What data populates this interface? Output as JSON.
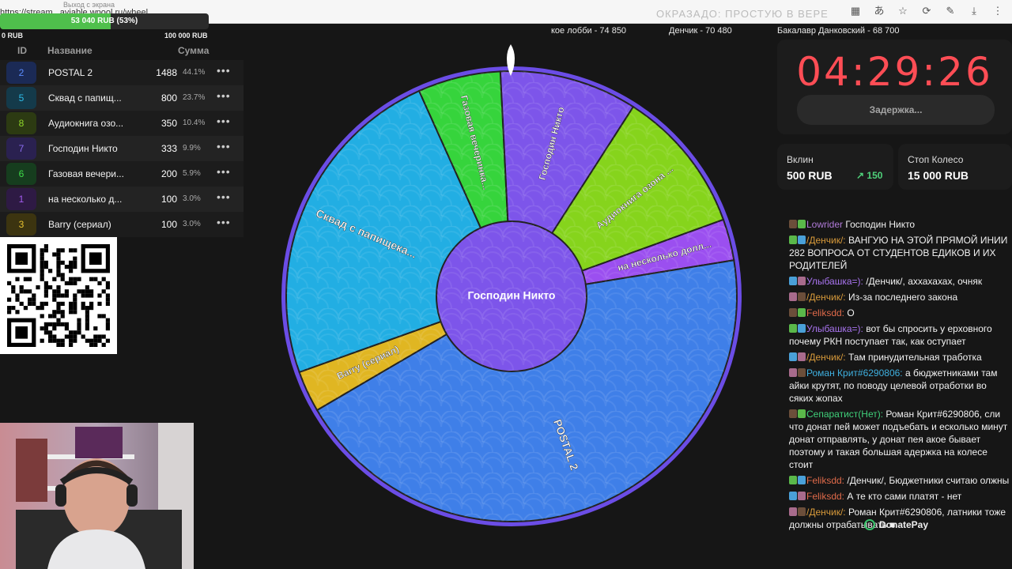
{
  "browser": {
    "url": "https://stream...aviable.wpool.ru/wheel",
    "tab_title": "Выход с экрана",
    "faded_overlay": "ОКРАЗАДО: ПРОСТУЮ В ВЕРЕ"
  },
  "progress": {
    "label": "53 040 RUB (53%)",
    "fraction": 0.53,
    "min_label": "0 RUB",
    "max_label": "100 000 RUB"
  },
  "table": {
    "headers": {
      "id": "ID",
      "name": "Название",
      "sum": "Сумма"
    },
    "rows": [
      {
        "id": "2",
        "name": "POSTAL 2",
        "sum": "1488",
        "pct": "44.1%",
        "color": "#1b2a55",
        "text_color": "#5b8cff"
      },
      {
        "id": "5",
        "name": "Сквад с папищ...",
        "sum": "800",
        "pct": "23.7%",
        "color": "#143a4a",
        "text_color": "#2dbce8"
      },
      {
        "id": "8",
        "name": "Аудиокнига озо...",
        "sum": "350",
        "pct": "10.4%",
        "color": "#2c3a12",
        "text_color": "#8fd82a"
      },
      {
        "id": "7",
        "name": "Господин Никто",
        "sum": "333",
        "pct": "9.9%",
        "color": "#2a2150",
        "text_color": "#8b6cf0"
      },
      {
        "id": "6",
        "name": "Газовая вечери...",
        "sum": "200",
        "pct": "5.9%",
        "color": "#163d1e",
        "text_color": "#3fdc4a"
      },
      {
        "id": "1",
        "name": "на несколько д...",
        "sum": "100",
        "pct": "3.0%",
        "color": "#2e1a44",
        "text_color": "#a35cf0"
      },
      {
        "id": "3",
        "name": "Barry (сериал)",
        "sum": "100",
        "pct": "3.0%",
        "color": "#3c3410",
        "text_color": "#e8c230"
      }
    ],
    "menu_glyph": "•••"
  },
  "leaders": [
    "кое лобби - 74 850",
    "Денчик - 70 480",
    "Бакалавр Данковский - 68 700"
  ],
  "wheel": {
    "center_label": "Господин Никто",
    "segments": [
      {
        "label": "Господин Никто",
        "value": 333,
        "color": "#7d55ea"
      },
      {
        "label": "Аудиокнига озона ...",
        "value": 350,
        "color": "#86d41c"
      },
      {
        "label": "на несколько долл...",
        "value": 100,
        "color": "#9b4ff0"
      },
      {
        "label": "POSTAL 2",
        "value": 1488,
        "color": "#3f7fe8"
      },
      {
        "label": "Barry (сериал)",
        "value": 100,
        "color": "#e0b622"
      },
      {
        "label": "Сквад с папищека...",
        "value": 800,
        "color": "#22aee3"
      },
      {
        "label": "Газовая вечеринка...",
        "value": 200,
        "color": "#36d43c"
      }
    ],
    "rim_color": "#6b4de6"
  },
  "timer": {
    "value": "04:29:26",
    "delay_button": "Задержка..."
  },
  "stats": {
    "entry_label": "Вклин",
    "entry_value": "500 RUB",
    "entry_increment": "150",
    "stop_label": "Стоп Колесо",
    "stop_value": "15 000 RUB"
  },
  "chat": {
    "messages": [
      {
        "user": "Lowrider",
        "user_color": "#b07ad8",
        "text": "Господин Никто"
      },
      {
        "user": "/Денчик/:",
        "user_color": "#d89a3a",
        "text": "ВАНГУЮ НА ЭТОЙ ПРЯМОЙ ИНИИ 282 ВОПРОСА ОТ СТУДЕНТОВ ЕДИКОВ И ИХ РОДИТЕЛЕЙ"
      },
      {
        "user": "Улыбашка=):",
        "user_color": "#a974f0",
        "text": "/Денчик/, аххахахах, очняк"
      },
      {
        "user": "/Денчик/:",
        "user_color": "#d89a3a",
        "text": "Из-за последнего закона"
      },
      {
        "user": "Feliksdd:",
        "user_color": "#e06a4a",
        "text": "О"
      },
      {
        "user": "Улыбашка=):",
        "user_color": "#a974f0",
        "text": "вот бы спросить у ерховного почему РКН поступает так, как оступает"
      },
      {
        "user": "/Денчик/:",
        "user_color": "#d89a3a",
        "text": "Там принудительная тработка"
      },
      {
        "user": "Роман Крит#6290806:",
        "user_color": "#3fb0e0",
        "text": "а бюджетниками там айки крутят, по поводу целевой отработки во сяких жопах"
      },
      {
        "user": "Сепаратист(Нет):",
        "user_color": "#3fd07a",
        "text": "Роман Крит#6290806, сли что донат пей может подъебать и есколько минут донат отправлять, у донат пея акое бывает поэтому и такая большая адержка на колесе стоит"
      },
      {
        "user": "Feliksdd:",
        "user_color": "#e06a4a",
        "text": "/Денчик/, Бюджетники считаю олжны"
      },
      {
        "user": "Feliksdd:",
        "user_color": "#e06a4a",
        "text": "А те кто сами платят - нет"
      },
      {
        "user": "/Денчик/:",
        "user_color": "#d89a3a",
        "text": "Роман Крит#6290806, латники тоже должны отрабатывать ■"
      }
    ],
    "donatepay_label": "DonatePay"
  }
}
